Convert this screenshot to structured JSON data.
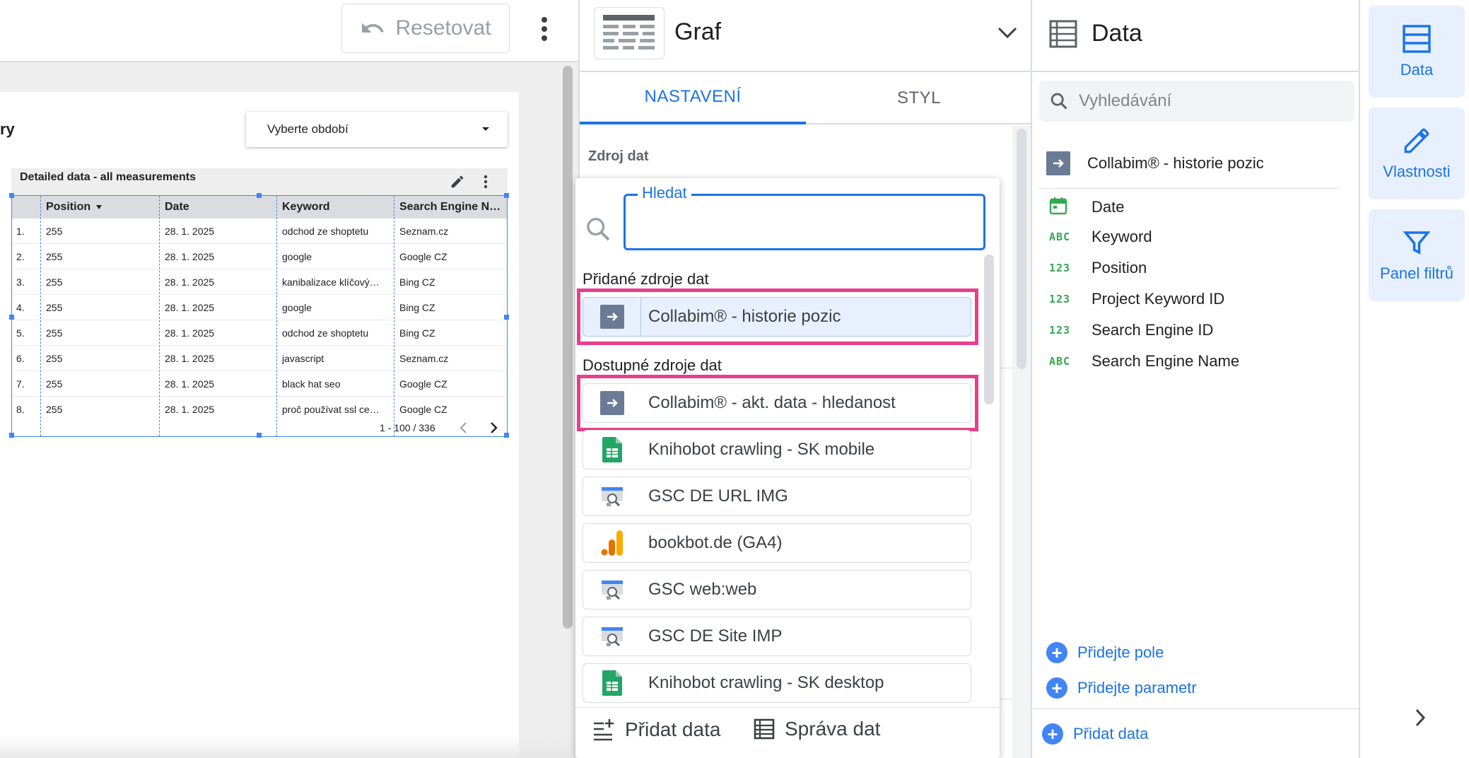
{
  "toolbar": {
    "reset_label": "Resetovat"
  },
  "report": {
    "title_fragment": "ry",
    "period_placeholder": "Vyberte období",
    "table": {
      "title": "Detailed data - all measurements",
      "columns": [
        "Position",
        "Date",
        "Keyword",
        "Search Engine N…"
      ],
      "rows": [
        {
          "idx": "1.",
          "position": "255",
          "date": "28. 1. 2025",
          "keyword": "odchod ze shoptetu",
          "engine": "Seznam.cz"
        },
        {
          "idx": "2.",
          "position": "255",
          "date": "28. 1. 2025",
          "keyword": "google",
          "engine": "Google CZ"
        },
        {
          "idx": "3.",
          "position": "255",
          "date": "28. 1. 2025",
          "keyword": "kanibalizace klíčový…",
          "engine": "Bing CZ"
        },
        {
          "idx": "4.",
          "position": "255",
          "date": "28. 1. 2025",
          "keyword": "google",
          "engine": "Bing CZ"
        },
        {
          "idx": "5.",
          "position": "255",
          "date": "28. 1. 2025",
          "keyword": "odchod ze shoptetu",
          "engine": "Bing CZ"
        },
        {
          "idx": "6.",
          "position": "255",
          "date": "28. 1. 2025",
          "keyword": "javascript",
          "engine": "Seznam.cz"
        },
        {
          "idx": "7.",
          "position": "255",
          "date": "28. 1. 2025",
          "keyword": "black hat seo",
          "engine": "Google CZ"
        },
        {
          "idx": "8.",
          "position": "255",
          "date": "28. 1. 2025",
          "keyword": "proč používat ssl ce…",
          "engine": "Google CZ"
        }
      ],
      "pagination": "1 - 100 / 336"
    }
  },
  "properties": {
    "chart_title": "Graf",
    "tabs": [
      {
        "label": "NASTAVENÍ",
        "active": true
      },
      {
        "label": "STYL",
        "active": false
      }
    ],
    "source_label": "Zdroj dat"
  },
  "source_dropdown": {
    "search_label": "Hledat",
    "search_value": "",
    "added_label": "Přidané zdroje dat",
    "available_label": "Dostupné zdroje dat",
    "added_sources": [
      {
        "name": "Collabim® - historie pozic",
        "icon": "connector-arrow-icon"
      }
    ],
    "available_sources": [
      {
        "name": "Collabim® - akt. data - hledanost",
        "icon": "connector-arrow-icon"
      },
      {
        "name": "Knihobot crawling - SK mobile",
        "icon": "google-sheets-icon"
      },
      {
        "name": "GSC DE URL IMG",
        "icon": "search-console-icon"
      },
      {
        "name": "bookbot.de (GA4)",
        "icon": "google-analytics-icon"
      },
      {
        "name": "GSC web:web",
        "icon": "search-console-icon"
      },
      {
        "name": "GSC DE Site IMP",
        "icon": "search-console-icon"
      },
      {
        "name": "Knihobot crawling - SK desktop",
        "icon": "google-sheets-icon"
      }
    ],
    "footer": {
      "add_data": "Přidat data",
      "manage_data": "Správa dat"
    },
    "highlight_color": "#e83e8c"
  },
  "data_panel": {
    "title": "Data",
    "search_placeholder": "Vyhledávání",
    "datasource": "Collabim® - historie pozic",
    "fields": [
      {
        "type": "date",
        "type_label": "",
        "name": "Date"
      },
      {
        "type": "text",
        "type_label": "ABC",
        "name": "Keyword"
      },
      {
        "type": "number",
        "type_label": "123",
        "name": "Position"
      },
      {
        "type": "number",
        "type_label": "123",
        "name": "Project Keyword ID"
      },
      {
        "type": "number",
        "type_label": "123",
        "name": "Search Engine ID"
      },
      {
        "type": "text",
        "type_label": "ABC",
        "name": "Search Engine Name"
      }
    ],
    "add_field": "Přidejte pole",
    "add_parameter": "Přidejte parametr",
    "add_data": "Přidat data"
  },
  "rail": {
    "items": [
      {
        "label": "Data",
        "icon": "database-icon"
      },
      {
        "label": "Vlastnosti",
        "icon": "pencil-icon"
      },
      {
        "label": "Panel filtrů",
        "icon": "filter-icon"
      }
    ]
  },
  "colors": {
    "accent": "#1a73e8",
    "selection": "#4285f4",
    "field_type": "#34a853"
  }
}
